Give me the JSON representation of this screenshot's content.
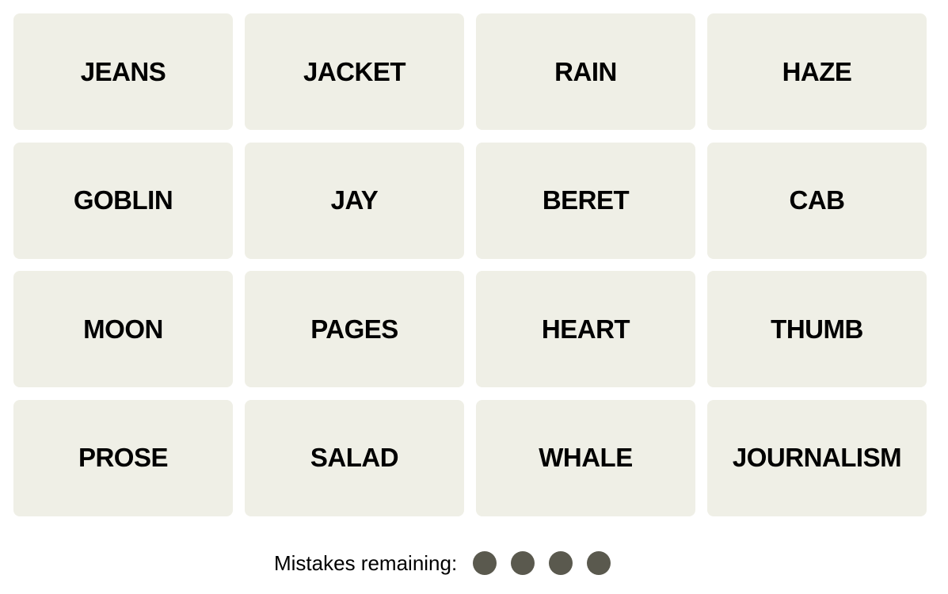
{
  "tiles": [
    "JEANS",
    "JACKET",
    "RAIN",
    "HAZE",
    "GOBLIN",
    "JAY",
    "BERET",
    "CAB",
    "MOON",
    "PAGES",
    "HEART",
    "THUMB",
    "PROSE",
    "SALAD",
    "WHALE",
    "JOURNALISM"
  ],
  "mistakes": {
    "label": "Mistakes remaining:",
    "remaining": 4,
    "total": 4,
    "dot_color": "#5a594e"
  },
  "colors": {
    "tile_bg": "#efefe6",
    "text": "#000000"
  }
}
